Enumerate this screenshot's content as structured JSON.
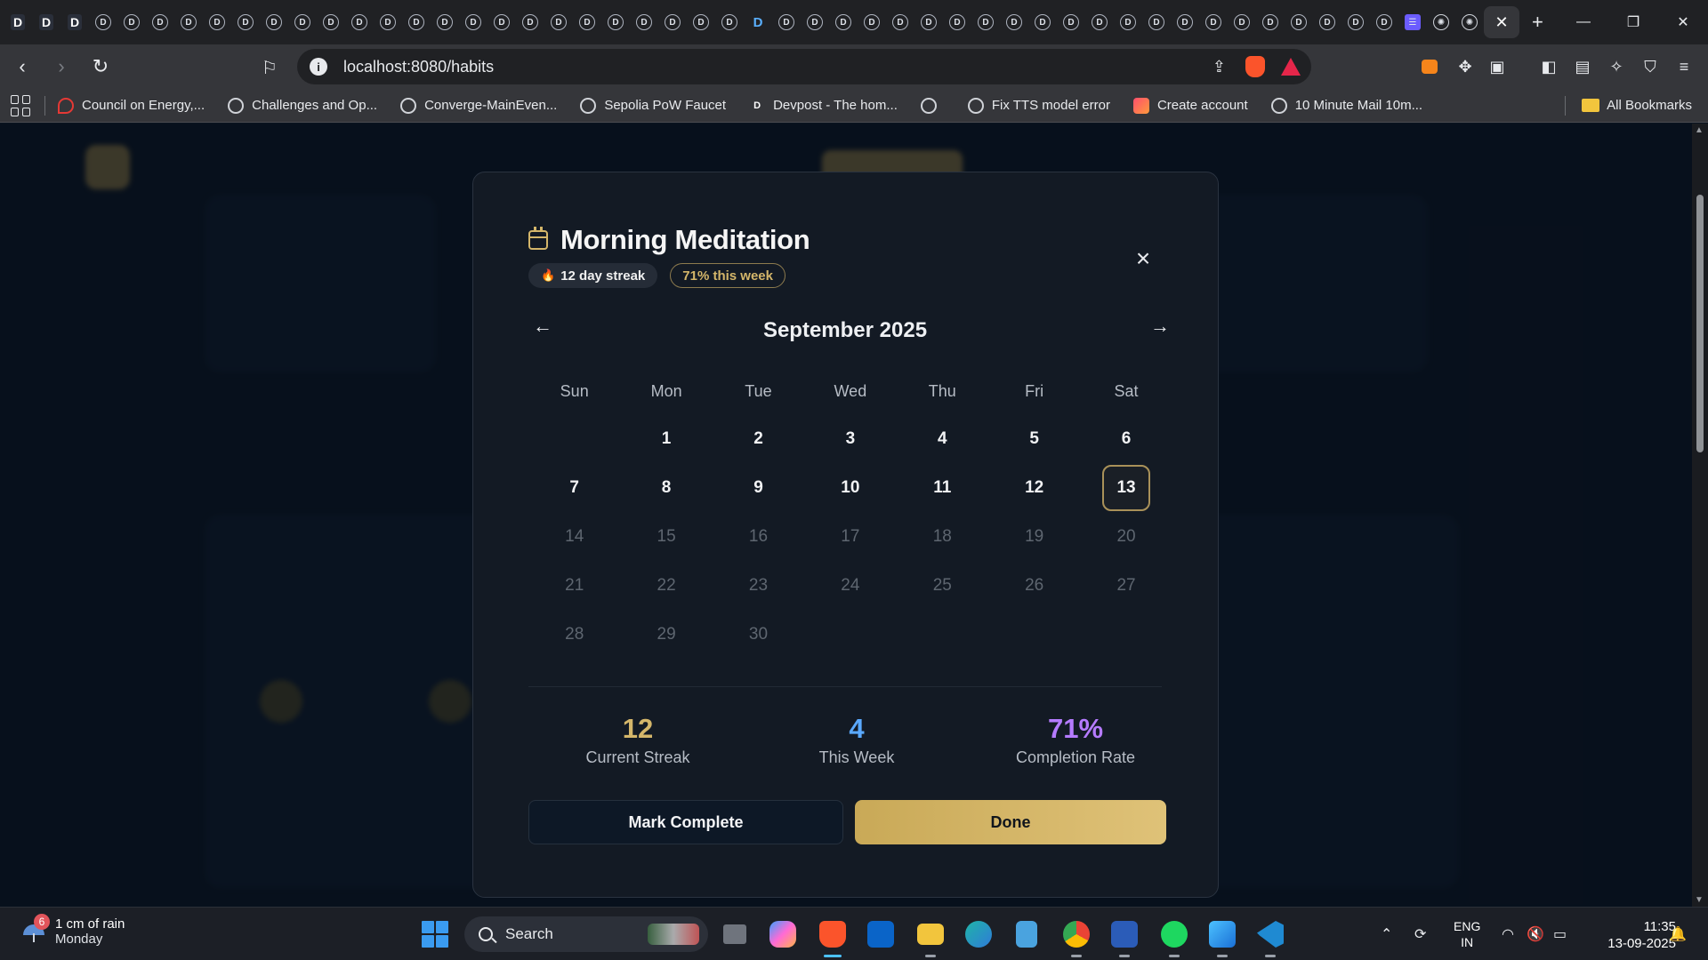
{
  "browser": {
    "url": "localhost:8080/habits",
    "tab_glyphs": [
      "D",
      "D",
      "D",
      "D",
      "D",
      "D",
      "D",
      "D",
      "D",
      "D",
      "D",
      "D",
      "D",
      "D",
      "D",
      "D",
      "D",
      "D",
      "D",
      "D",
      "D",
      "D",
      "D",
      "D",
      "D",
      "D",
      "D",
      "D",
      "D",
      "D",
      "D",
      "D",
      "D",
      "D",
      "D",
      "D",
      "D",
      "D",
      "D",
      "D",
      "D",
      "D",
      "D",
      "D",
      "D",
      "D",
      "D",
      "D",
      "D"
    ],
    "bookmarks": [
      {
        "label": "Council on Energy,...",
        "icon": "red-pin-icon"
      },
      {
        "label": "Challenges and Op...",
        "icon": "globe-icon"
      },
      {
        "label": "Converge-MainEven...",
        "icon": "globe-icon"
      },
      {
        "label": "Sepolia PoW Faucet",
        "icon": "globe-icon"
      },
      {
        "label": "Devpost - The hom...",
        "icon": "devpost-icon"
      },
      {
        "label": "",
        "icon": "globe-icon"
      },
      {
        "label": "Fix TTS model error",
        "icon": "openai-icon"
      },
      {
        "label": "Create account",
        "icon": "gradient-app-icon"
      },
      {
        "label": "10 Minute Mail 10m...",
        "icon": "globe-icon"
      }
    ],
    "all_bookmarks": "All Bookmarks",
    "devpost_glyph": "D"
  },
  "modal": {
    "title": "Morning Meditation",
    "streak_badge": "12 day streak",
    "week_badge": "71% this week",
    "month_label": "September 2025",
    "prev_arrow": "←",
    "next_arrow": "→",
    "close_glyph": "×",
    "weekdays": [
      "Sun",
      "Mon",
      "Tue",
      "Wed",
      "Thu",
      "Fri",
      "Sat"
    ],
    "days": [
      {
        "label": "",
        "state": "empty"
      },
      {
        "label": "1",
        "state": "past"
      },
      {
        "label": "2",
        "state": "past"
      },
      {
        "label": "3",
        "state": "past"
      },
      {
        "label": "4",
        "state": "past"
      },
      {
        "label": "5",
        "state": "past"
      },
      {
        "label": "6",
        "state": "past"
      },
      {
        "label": "7",
        "state": "past"
      },
      {
        "label": "8",
        "state": "past"
      },
      {
        "label": "9",
        "state": "past"
      },
      {
        "label": "10",
        "state": "past"
      },
      {
        "label": "11",
        "state": "past"
      },
      {
        "label": "12",
        "state": "past"
      },
      {
        "label": "13",
        "state": "today"
      },
      {
        "label": "14",
        "state": "future"
      },
      {
        "label": "15",
        "state": "future"
      },
      {
        "label": "16",
        "state": "future"
      },
      {
        "label": "17",
        "state": "future"
      },
      {
        "label": "18",
        "state": "future"
      },
      {
        "label": "19",
        "state": "future"
      },
      {
        "label": "20",
        "state": "future"
      },
      {
        "label": "21",
        "state": "future"
      },
      {
        "label": "22",
        "state": "future"
      },
      {
        "label": "23",
        "state": "future"
      },
      {
        "label": "24",
        "state": "future"
      },
      {
        "label": "25",
        "state": "future"
      },
      {
        "label": "26",
        "state": "future"
      },
      {
        "label": "27",
        "state": "future"
      },
      {
        "label": "28",
        "state": "future"
      },
      {
        "label": "29",
        "state": "future"
      },
      {
        "label": "30",
        "state": "future"
      }
    ],
    "stats": [
      {
        "value": "12",
        "label": "Current Streak",
        "color": "#d4b66a"
      },
      {
        "value": "4",
        "label": "This Week",
        "color": "#5aa9ff"
      },
      {
        "value": "71%",
        "label": "Completion Rate",
        "color": "#b57bff"
      }
    ],
    "mark_complete_label": "Mark Complete",
    "done_label": "Done"
  },
  "colors": {
    "accent_gold": "#d4b66a",
    "modal_bg": "#131a24",
    "page_bg": "#0e1b2b"
  },
  "taskbar": {
    "weather_line1": "1 cm of rain",
    "weather_line2": "Monday",
    "weather_badge": "6",
    "search_label": "Search",
    "lang_line1": "ENG",
    "lang_line2": "IN",
    "time": "11:35",
    "date": "13-09-2025"
  }
}
